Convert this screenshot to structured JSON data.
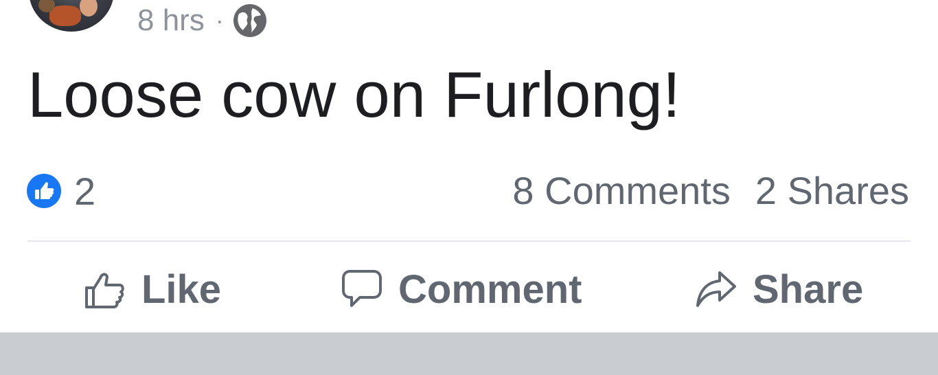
{
  "post": {
    "timestamp": "8 hrs",
    "separator": "·",
    "privacy_icon": "globe-icon",
    "text": "Loose cow on Furlong!"
  },
  "stats": {
    "reaction_icon": "like-reaction-icon",
    "reaction_count": "2",
    "comments_label": "8 Comments",
    "shares_label": "2 Shares"
  },
  "actions": {
    "like_label": "Like",
    "comment_label": "Comment",
    "share_label": "Share"
  },
  "colors": {
    "text_primary": "#1c1e21",
    "text_secondary": "#606770",
    "meta_gray": "#8d939b",
    "like_blue": "#1877f2",
    "divider": "#e4e6eb",
    "footer_gray": "#c9ccd1"
  }
}
